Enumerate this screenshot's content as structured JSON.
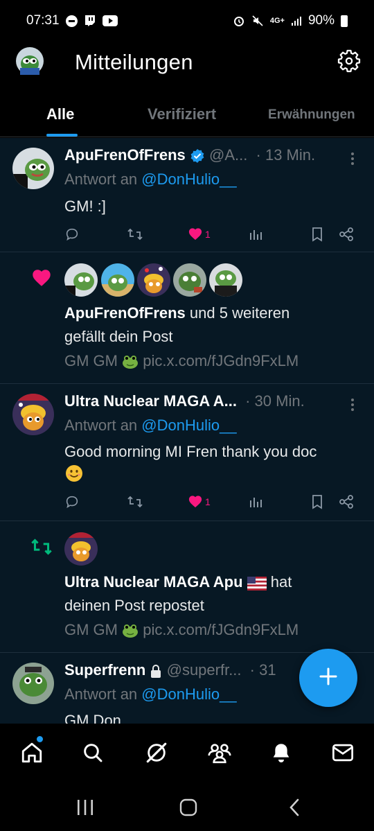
{
  "status_bar": {
    "time": "07:31",
    "battery": "90%",
    "network": "4G+"
  },
  "header": {
    "title": "Mitteilungen"
  },
  "tabs": [
    {
      "label": "Alle",
      "active": true
    },
    {
      "label": "Verifiziert",
      "active": false
    },
    {
      "label": "Erwähnungen",
      "active": false
    }
  ],
  "notifications": [
    {
      "type": "reply",
      "display_name": "ApuFrenOfFrens",
      "handle": "@A...",
      "time": "· 13 Min.",
      "reply_prefix": "Antwort an",
      "reply_to": "@DonHulio__",
      "text": "GM! :]",
      "like_count": "1"
    },
    {
      "type": "like",
      "actor": "ApuFrenOfFrens",
      "summary": "und 5 weiteren",
      "summary_line2": "gefällt dein Post",
      "post_preview_prefix": "GM GM",
      "post_preview_link": "pic.x.com/fJGdn9FxLM"
    },
    {
      "type": "reply",
      "display_name": "Ultra Nuclear MAGA A...",
      "time": "· 30 Min.",
      "reply_prefix": "Antwort an",
      "reply_to": "@DonHulio__",
      "text_line1": "Good morning MI Fren thank you doc",
      "like_count": "1"
    },
    {
      "type": "repost",
      "actor": "Ultra Nuclear MAGA Apu",
      "summary": "hat",
      "summary_line2": "deinen Post repostet",
      "post_preview_prefix": "GM GM",
      "post_preview_link": "pic.x.com/fJGdn9FxLM"
    },
    {
      "type": "reply",
      "display_name": "Superfrenn",
      "handle": "@superfr...",
      "time": "· 31",
      "reply_prefix": "Antwort an",
      "reply_to": "@DonHulio__",
      "text": "GM Don"
    }
  ],
  "colors": {
    "accent": "#1d9bf0",
    "like": "#f91880",
    "repost": "#00ba7c",
    "feed_bg": "#071824"
  },
  "bottom_nav": [
    "home-icon",
    "search-icon",
    "grok-icon",
    "communities-icon",
    "notifications-icon",
    "messages-icon"
  ],
  "system_nav": [
    "recents-icon",
    "home-circle-icon",
    "back-icon"
  ]
}
